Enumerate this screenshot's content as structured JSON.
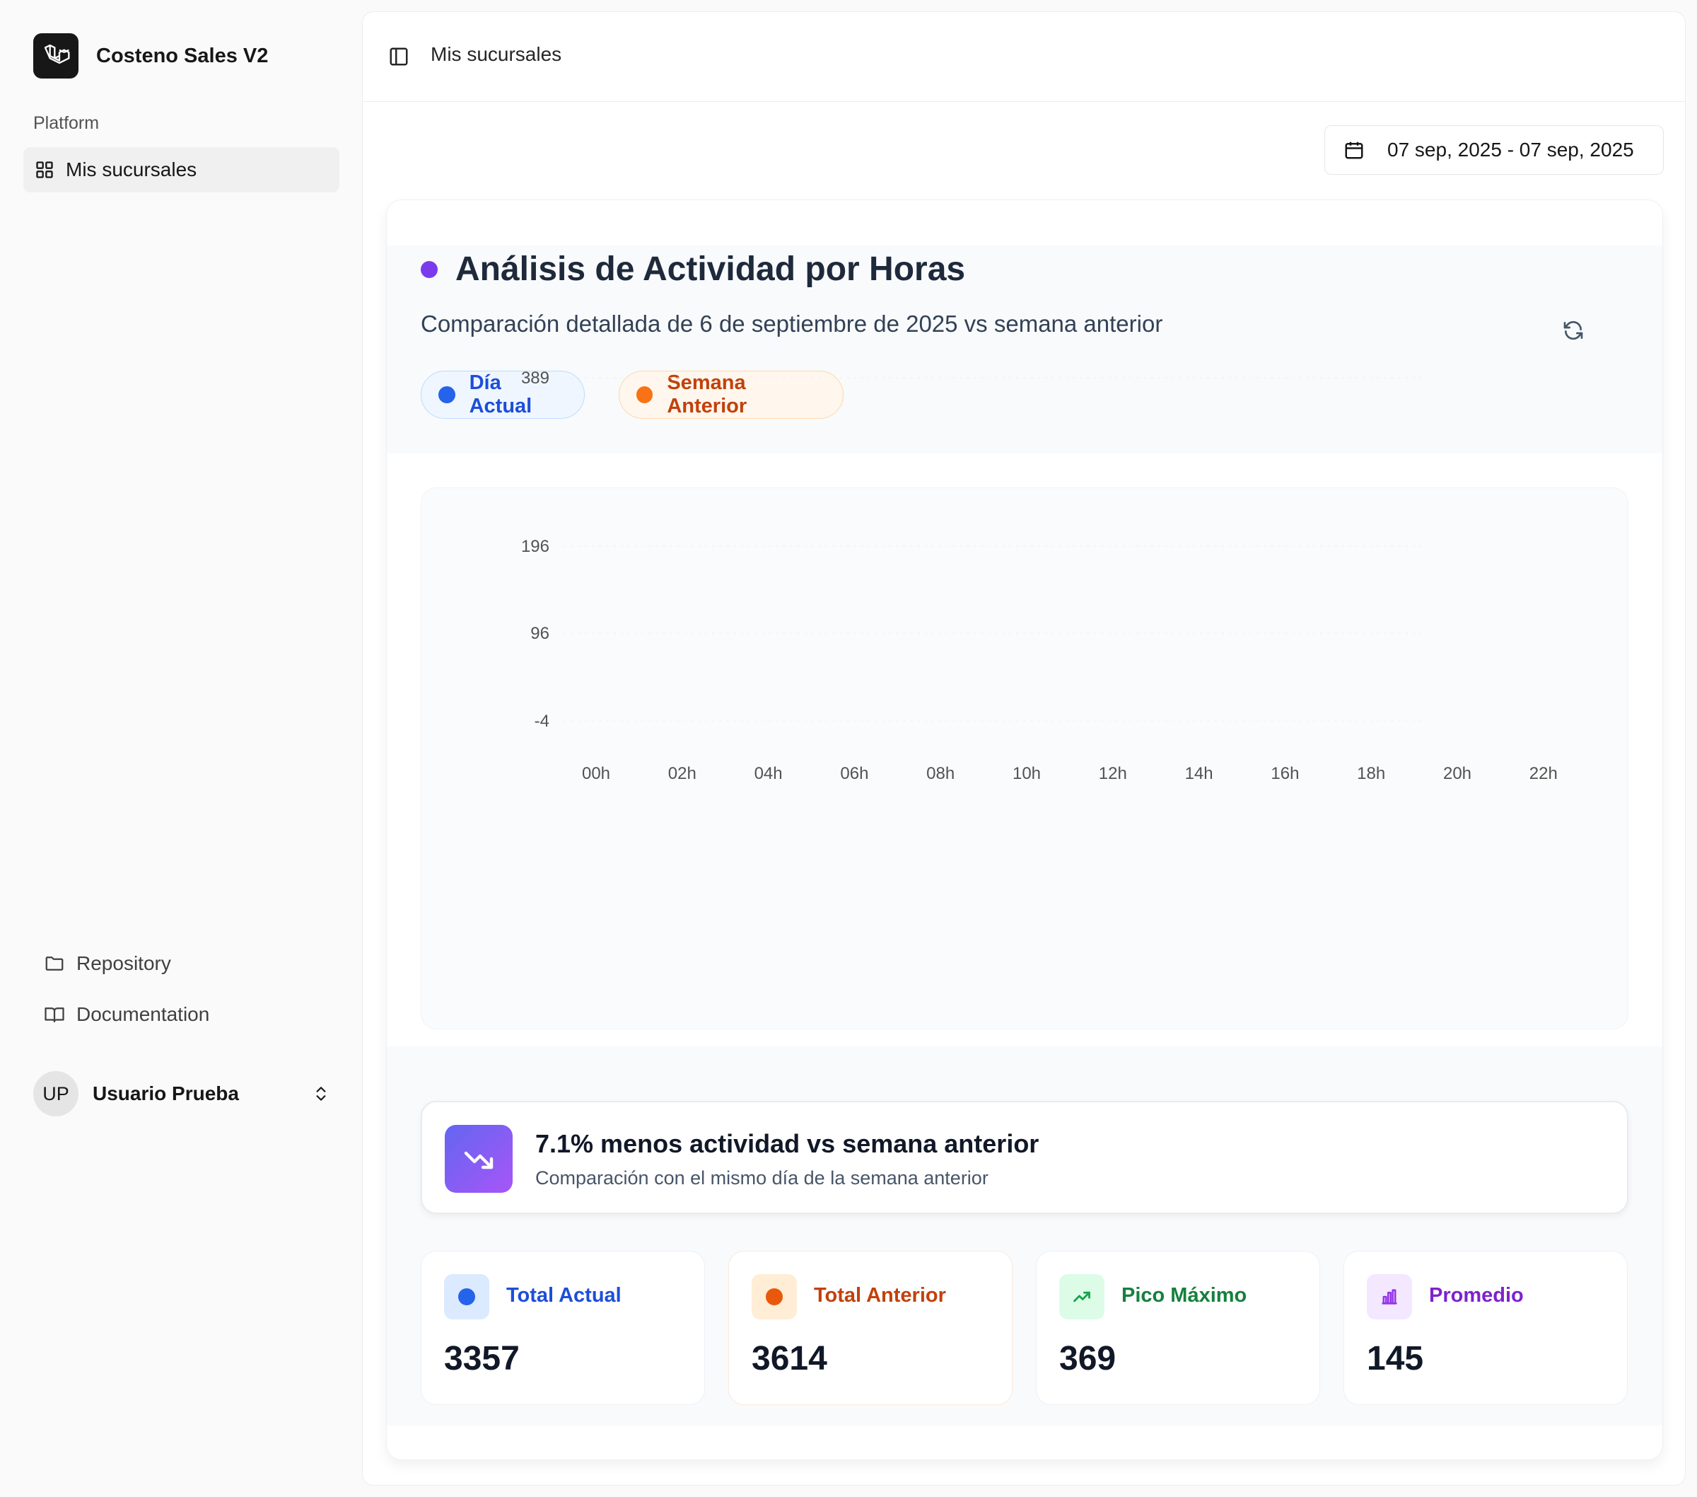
{
  "app": {
    "name": "Costeno Sales V2",
    "logo_icon": "laravel-logo-icon"
  },
  "sidebar": {
    "section_label": "Platform",
    "nav_items": [
      {
        "label": "Mis sucursales",
        "icon": "grid-icon",
        "active": true
      }
    ],
    "footer_links": [
      {
        "label": "Repository",
        "icon": "folder-icon"
      },
      {
        "label": "Documentation",
        "icon": "book-icon"
      }
    ],
    "user": {
      "initials": "UP",
      "name": "Usuario Prueba"
    }
  },
  "header": {
    "title": "Mis sucursales",
    "toggle_icon": "sidebar-toggle-icon"
  },
  "date_range": {
    "label": "07 sep, 2025 - 07 sep, 2025",
    "icon": "calendar-icon"
  },
  "card": {
    "title": "Análisis de Actividad por Horas",
    "subtitle": "Comparación detallada de 6 de septiembre de 2025 vs semana anterior",
    "legend": [
      {
        "label": "Día Actual",
        "color": "#2563eb"
      },
      {
        "label": "Semana Anterior",
        "color": "#f97316"
      }
    ]
  },
  "chart_data": {
    "type": "line",
    "y_ticks": [
      "389",
      "196",
      "96",
      "-4"
    ],
    "x_ticks": [
      "00h",
      "02h",
      "04h",
      "06h",
      "08h",
      "10h",
      "12h",
      "14h",
      "16h",
      "18h",
      "20h",
      "22h"
    ],
    "series": [
      {
        "name": "Día Actual",
        "color": "#2563eb",
        "values": []
      },
      {
        "name": "Semana Anterior",
        "color": "#f97316",
        "values": []
      }
    ],
    "grid": true
  },
  "insight": {
    "title": "7.1% menos actividad vs semana anterior",
    "subtitle": "Comparación con el mismo día de la semana anterior",
    "icon": "trending-down-icon"
  },
  "stats": [
    {
      "label": "Total Actual",
      "value": "3357",
      "color": "#1d4ed8",
      "bg": "#dbeafe",
      "icon": "blue-dot-icon"
    },
    {
      "label": "Total Anterior",
      "value": "3614",
      "color": "#c2410c",
      "bg": "#ffedd5",
      "icon": "orange-dot-icon"
    },
    {
      "label": "Pico Máximo",
      "value": "369",
      "color": "#15803d",
      "bg": "#dcfce7",
      "icon": "trending-up-icon"
    },
    {
      "label": "Promedio",
      "value": "145",
      "color": "#7e22ce",
      "bg": "#f3e8ff",
      "icon": "bar-chart-icon"
    }
  ]
}
